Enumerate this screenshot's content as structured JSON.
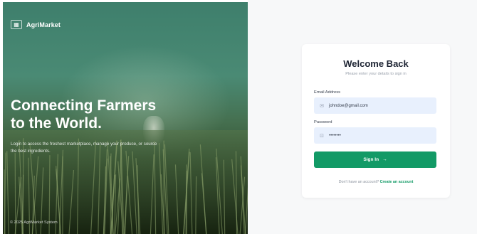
{
  "brand": {
    "name": "AgriMarket",
    "logo_icon": "grid-logo-icon"
  },
  "hero": {
    "headline_line1": "Connecting Farmers",
    "headline_line2": "to the World.",
    "description": "Login to access the freshest marketplace, manage your produce, or source the best ingredients.",
    "copyright": "© 2025 AgriMarket System"
  },
  "login": {
    "title": "Welcome Back",
    "subtitle": "Please enter your details to sign in",
    "email_label": "Email Address",
    "email_value": "johndoe@gmail.com",
    "email_icon": "mail-icon",
    "password_label": "Password",
    "password_value": "••••••••",
    "password_icon": "lock-icon",
    "signin_label": "Sign In",
    "signin_icon": "arrow-right-icon",
    "signup_prompt": "Don't have an account?",
    "signup_link": "Create an account"
  },
  "colors": {
    "accent": "#129a66",
    "input_bg": "#e8f0fd",
    "hero_top": "#3e7f6c",
    "hero_bottom": "#1e2f1b"
  }
}
